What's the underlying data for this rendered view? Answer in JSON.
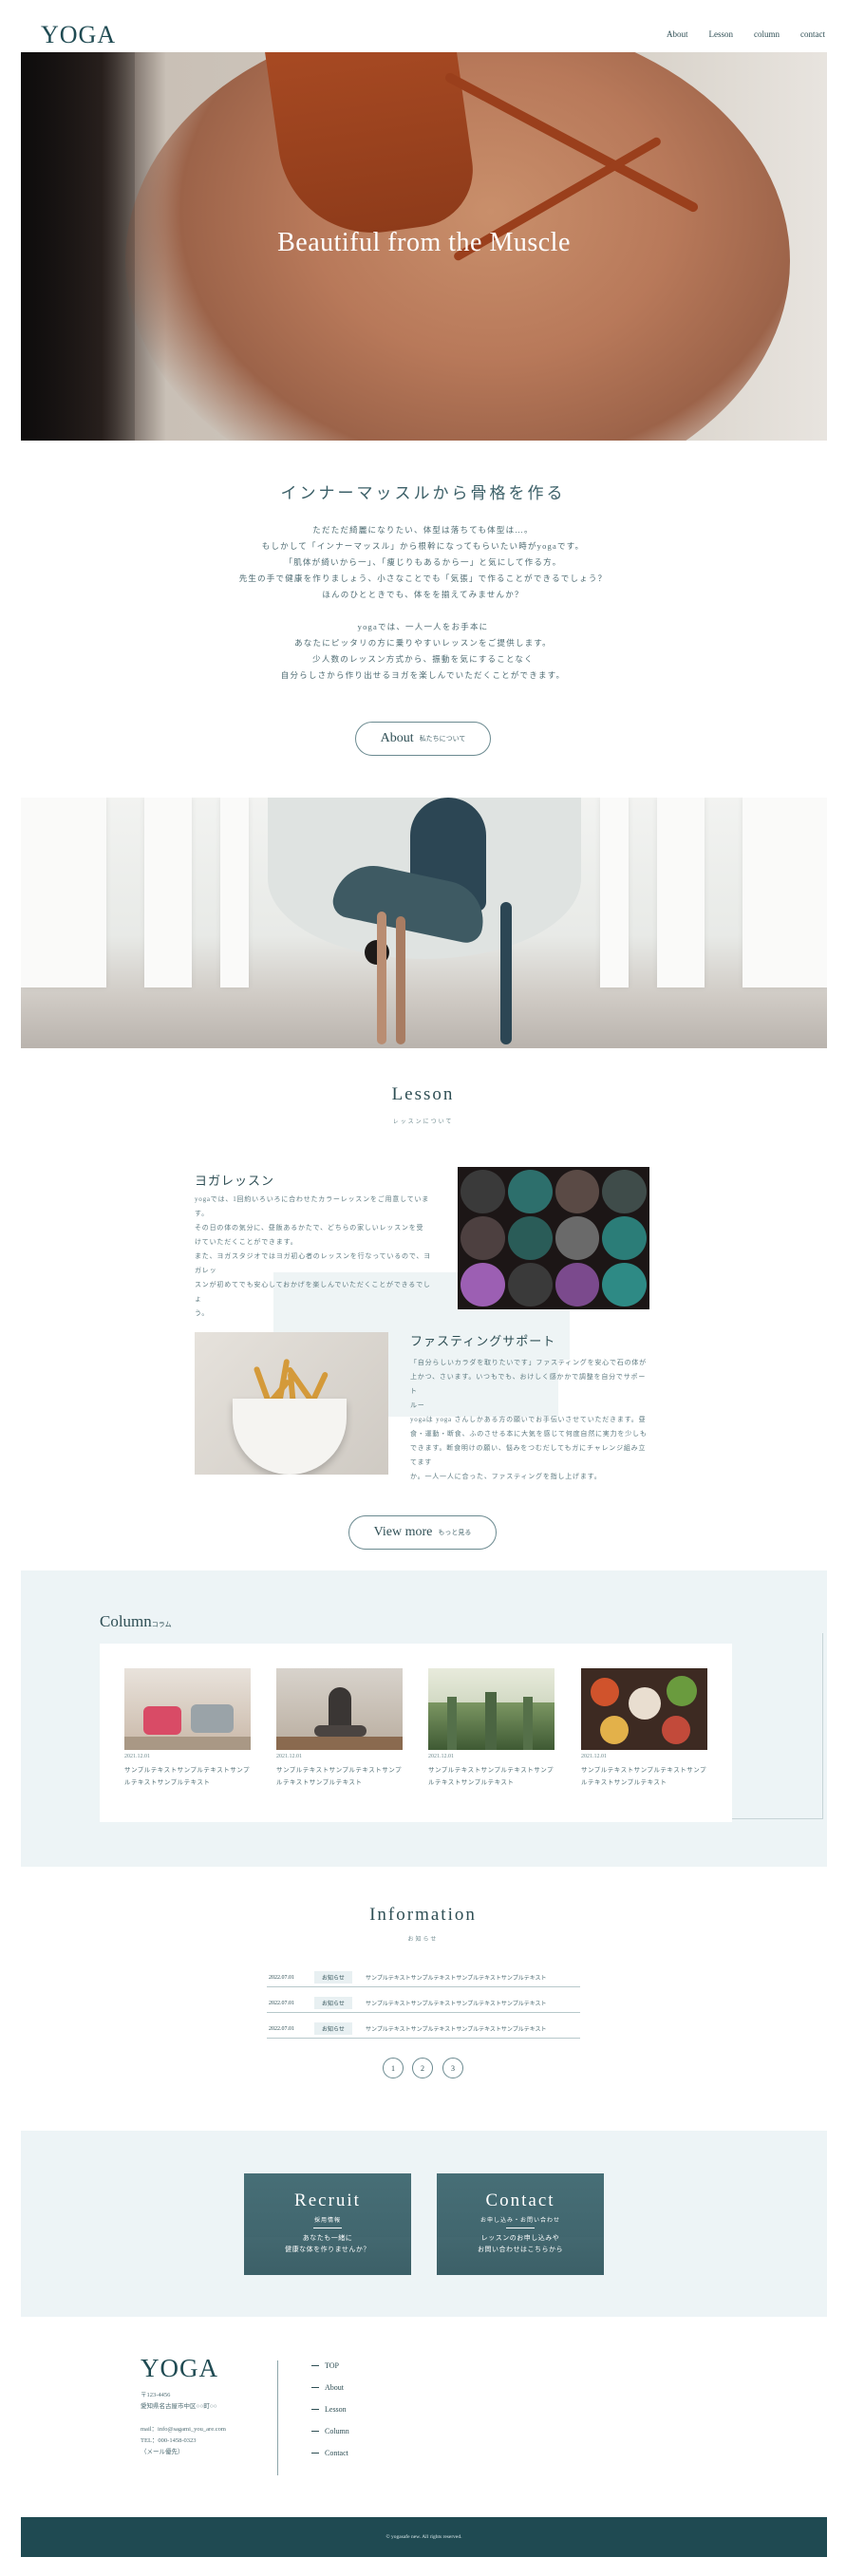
{
  "header": {
    "logo": "YOGA",
    "nav": [
      "About",
      "Lesson",
      "column",
      "contact"
    ]
  },
  "hero": {
    "title": "Beautiful from the Muscle"
  },
  "intro": {
    "title": "インナーマッスルから骨格を作る",
    "paragraph1": [
      "ただただ綺麗になりたい、体型は落ちても体型は…。",
      "もしかして「インナーマッスル」から根幹になってもらいたい時がyogaです。",
      "「肌体が綺いから一」、「痩じりもあるから一」と気にして作る方。",
      "先生の手で健康を作りましょう、小さなことでも「気張」で作ることができるでしょう？",
      "ほんのひとときでも、体をを揃えてみませんか？"
    ],
    "paragraph2": [
      "yogaでは、一人一人をお手本に",
      "あなたにピッタリの方に乗りやすいレッスンをご提供します。",
      "少人数のレッスン方式から、振動を気にすることなく",
      "自分らしさから作り出せるヨガを楽しんでいただくことができます。"
    ],
    "button_main": "About",
    "button_sub": "私たちについて"
  },
  "lesson": {
    "title": "Lesson",
    "subtitle": "レッスンについて",
    "yoga_title": "ヨガレッスン",
    "yoga_text": [
      "yogaでは、1回約いろいろに合わせたカラーレッスンをご用意しています。",
      "その日の体の気分に、昼飯あるかたで、どちらの家しいレッスンを受",
      "けていただくことができます。",
      "また、ヨガスタジオではヨガ初心者のレッスンを行なっているので、ヨガレッ",
      "スンが初めてでも安心しておかげを楽しんでいただくことができるでしょ",
      "う。"
    ],
    "fasting_title": "ファスティングサポート",
    "fasting_text": [
      "「自分らしいカラダを取りたいです」ファスティングを安心で石の体が",
      "上かつ、さいます。いつもでも、おけしく感かかで調整を自分でサポート",
      "ルー",
      "yogaは yoga さんしかある方の願いでお手伝いさせていただきます。昼",
      "食・運動・断食、ふのさせる本に大気を感じて何度自然に実力を少しも",
      "できます。断食明けの願い、悩みをつむだしてもガにチャレンジ組み立てます",
      "か。一人一人に合った、ファスティングを指し上げます。"
    ],
    "button_main": "View more",
    "button_sub": "もっと見る"
  },
  "column": {
    "title": "Column",
    "title_sub": "コラム",
    "items": [
      {
        "date": "2021.12.01",
        "text": "サンプルテキストサンプルテキストサンプルテキストサンプルテキスト"
      },
      {
        "date": "2021.12.01",
        "text": "サンプルテキストサンプルテキストサンプルテキストサンプルテキスト"
      },
      {
        "date": "2021.12.01",
        "text": "サンプルテキストサンプルテキストサンプルテキストサンプルテキスト"
      },
      {
        "date": "2021.12.01",
        "text": "サンプルテキストサンプルテキストサンプルテキストサンプルテキスト"
      }
    ]
  },
  "information": {
    "title": "Information",
    "subtitle": "お知らせ",
    "rows": [
      {
        "date": "2022.07.01",
        "badge": "お知らせ",
        "text": "サンプルテキストサンプルテキストサンプルテキストサンプルテキスト"
      },
      {
        "date": "2022.07.01",
        "badge": "お知らせ",
        "text": "サンプルテキストサンプルテキストサンプルテキストサンプルテキスト"
      },
      {
        "date": "2022.07.01",
        "badge": "お知らせ",
        "text": "サンプルテキストサンプルテキストサンプルテキストサンプルテキスト"
      }
    ],
    "pages": [
      "1",
      "2",
      "3"
    ]
  },
  "recruit": {
    "title": "Recruit",
    "sub": "採用情報",
    "desc": [
      "あなたも一緒に",
      "健康な体を作りませんか？"
    ]
  },
  "contact": {
    "title": "Contact",
    "sub": "お申し込み・お問い合わせ",
    "desc": [
      "レッスンのお申し込みや",
      "お問い合わせはこちらから"
    ]
  },
  "footer": {
    "logo": "YOGA",
    "address": [
      "〒123-4456",
      "愛知県名古屋市中区○○町○○"
    ],
    "contact": [
      "mail：info@sagami_you_are.com",
      "TEL：000-1458-0323",
      "（メール優先）"
    ],
    "nav": [
      "TOP",
      "About",
      "Lesson",
      "Column",
      "Contact"
    ],
    "copyright": "© yogasafe new. All rights reserved."
  }
}
